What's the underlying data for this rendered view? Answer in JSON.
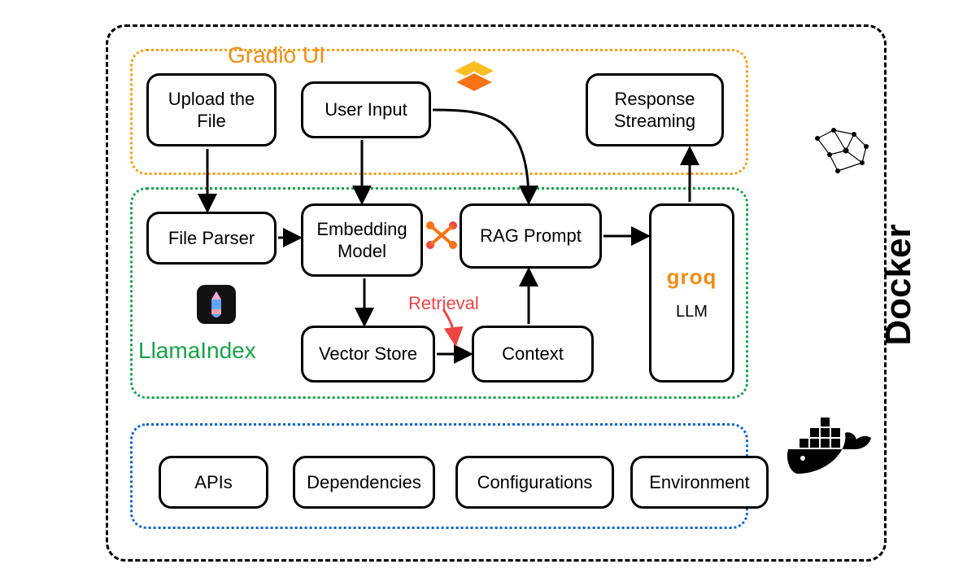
{
  "sections": {
    "ui": {
      "title": "Gradio UI"
    },
    "index": {
      "title": "LlamaIndex"
    },
    "container": {
      "title": "Docker"
    }
  },
  "nodes": {
    "upload": "Upload the\nFile",
    "user_input": "User Input",
    "response_streaming": "Response\nStreaming",
    "file_parser": "File Parser",
    "embedding_model": "Embedding\nModel",
    "rag_prompt": "RAG Prompt",
    "vector_store": "Vector Store",
    "context": "Context",
    "groq_brand": "groq",
    "groq_sub": "LLM",
    "apis": "APIs",
    "dependencies": "Dependencies",
    "configurations": "Configurations",
    "environment": "Environment"
  },
  "annotations": {
    "retrieval": "Retrieval"
  },
  "icons": {
    "gradio": "gradio-logo-icon",
    "intermediate": "weave-icon",
    "llama": "llama-icon",
    "docker": "docker-whale-icon",
    "network": "network-graph-icon"
  },
  "colors": {
    "gradio_border": "#f59e0b",
    "llama_border": "#16a34a",
    "deps_border": "#0b63d6",
    "retrieval": "#ef4444",
    "brand_orange": "#f28c13"
  },
  "flows": [
    [
      "upload",
      "file_parser"
    ],
    [
      "user_input",
      "embedding_model"
    ],
    [
      "user_input",
      "rag_prompt"
    ],
    [
      "file_parser",
      "embedding_model"
    ],
    [
      "embedding_model",
      "vector_store"
    ],
    [
      "vector_store",
      "context",
      "retrieval"
    ],
    [
      "context",
      "rag_prompt"
    ],
    [
      "rag_prompt",
      "groq_llm"
    ],
    [
      "groq_llm",
      "response_streaming"
    ]
  ]
}
